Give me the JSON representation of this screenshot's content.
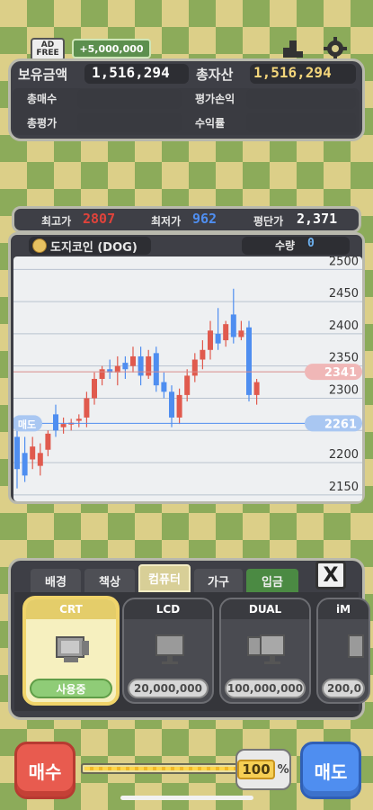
{
  "top": {
    "ad_free_label": "AD FREE",
    "reward_amount": "+5,000,000",
    "cash_label": "보유금액",
    "cash_value": "1,516,294",
    "assets_label": "총자산",
    "assets_value": "1,516,294",
    "buy_total_label": "총매수",
    "eval_pl_label": "평가손익",
    "eval_total_label": "총평가",
    "return_label": "수익률"
  },
  "stats": {
    "high_label": "최고가",
    "high_value": "2807",
    "low_label": "최저가",
    "low_value": "962",
    "avg_label": "평단가",
    "avg_value": "2,371"
  },
  "coin": {
    "name": "도지코인 (DOG)",
    "qty_label": "수량",
    "qty_value": "0"
  },
  "chart_data": {
    "type": "candlestick",
    "y_ticks": [
      "2500",
      "2450",
      "2400",
      "2350",
      "2300",
      "2250",
      "2200",
      "2150"
    ],
    "ylim": [
      2140,
      2520
    ],
    "current_price": "2341",
    "sell_line_label": "매도",
    "sell_line_value": "2261",
    "candles": [
      {
        "o": 2240,
        "c": 2190,
        "h": 2260,
        "l": 2160
      },
      {
        "o": 2215,
        "c": 2180,
        "h": 2240,
        "l": 2170
      },
      {
        "o": 2205,
        "c": 2225,
        "h": 2240,
        "l": 2190
      },
      {
        "o": 2195,
        "c": 2215,
        "h": 2230,
        "l": 2180
      },
      {
        "o": 2220,
        "c": 2245,
        "h": 2250,
        "l": 2210
      },
      {
        "o": 2275,
        "c": 2250,
        "h": 2290,
        "l": 2240
      },
      {
        "o": 2255,
        "c": 2260,
        "h": 2270,
        "l": 2245
      },
      {
        "o": 2260,
        "c": 2262,
        "h": 2268,
        "l": 2250
      },
      {
        "o": 2265,
        "c": 2268,
        "h": 2275,
        "l": 2255
      },
      {
        "o": 2270,
        "c": 2300,
        "h": 2310,
        "l": 2255
      },
      {
        "o": 2300,
        "c": 2330,
        "h": 2340,
        "l": 2290
      },
      {
        "o": 2330,
        "c": 2345,
        "h": 2350,
        "l": 2320
      },
      {
        "o": 2345,
        "c": 2340,
        "h": 2360,
        "l": 2330
      },
      {
        "o": 2340,
        "c": 2350,
        "h": 2365,
        "l": 2320
      },
      {
        "o": 2355,
        "c": 2345,
        "h": 2365,
        "l": 2330
      },
      {
        "o": 2350,
        "c": 2365,
        "h": 2380,
        "l": 2340
      },
      {
        "o": 2365,
        "c": 2335,
        "h": 2380,
        "l": 2320
      },
      {
        "o": 2335,
        "c": 2365,
        "h": 2375,
        "l": 2330
      },
      {
        "o": 2370,
        "c": 2320,
        "h": 2380,
        "l": 2310
      },
      {
        "o": 2325,
        "c": 2310,
        "h": 2340,
        "l": 2300
      },
      {
        "o": 2310,
        "c": 2270,
        "h": 2320,
        "l": 2255
      },
      {
        "o": 2270,
        "c": 2305,
        "h": 2315,
        "l": 2260
      },
      {
        "o": 2305,
        "c": 2335,
        "h": 2345,
        "l": 2295
      },
      {
        "o": 2335,
        "c": 2360,
        "h": 2370,
        "l": 2325
      },
      {
        "o": 2360,
        "c": 2375,
        "h": 2390,
        "l": 2345
      },
      {
        "o": 2375,
        "c": 2405,
        "h": 2420,
        "l": 2360
      },
      {
        "o": 2400,
        "c": 2385,
        "h": 2440,
        "l": 2375
      },
      {
        "o": 2390,
        "c": 2415,
        "h": 2420,
        "l": 2380
      },
      {
        "o": 2430,
        "c": 2395,
        "h": 2470,
        "l": 2385
      },
      {
        "o": 2395,
        "c": 2405,
        "h": 2420,
        "l": 2390
      },
      {
        "o": 2410,
        "c": 2305,
        "h": 2420,
        "l": 2295
      },
      {
        "o": 2305,
        "c": 2325,
        "h": 2330,
        "l": 2290
      }
    ]
  },
  "shop": {
    "tabs": [
      "배경",
      "책상",
      "컴퓨터",
      "가구",
      "입금"
    ],
    "close_label": "X",
    "items": [
      {
        "title": "CRT",
        "status": "사용중"
      },
      {
        "title": "LCD",
        "price": "20,000,000"
      },
      {
        "title": "DUAL",
        "price": "100,000,000"
      },
      {
        "title": "iM",
        "price": "200,0"
      }
    ]
  },
  "bottom": {
    "buy_label": "매수",
    "sell_label": "매도",
    "percent_value": "100",
    "percent_sign": "%"
  },
  "colors": {
    "up": "#e05a4e",
    "down": "#4f8ef0",
    "gold": "#f3d57a",
    "panel": "#3e3f46"
  }
}
